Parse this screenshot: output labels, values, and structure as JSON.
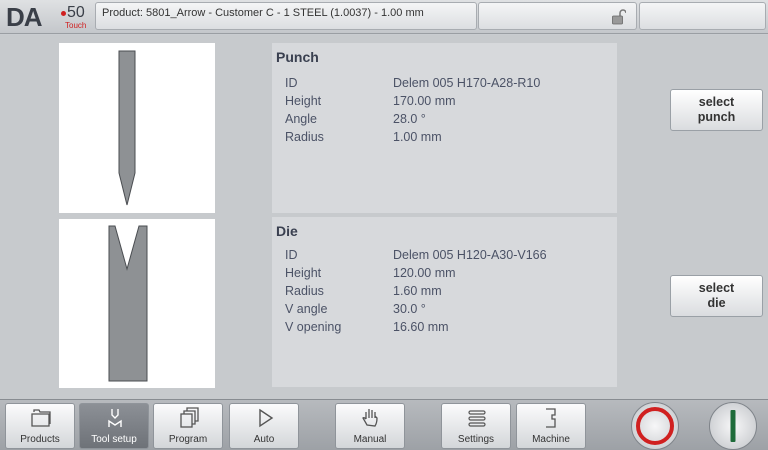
{
  "header": {
    "logo_text": "DA",
    "logo_model": "50",
    "logo_sub": "Touch",
    "product_title": "Product: 5801_Arrow - Customer C - 1 STEEL (1.0037) - 1.00 mm",
    "lock_icon": "unlocked-padlock-icon"
  },
  "punch": {
    "title": "Punch",
    "rows": [
      {
        "key": "ID",
        "value": "Delem 005 H170-A28-R10"
      },
      {
        "key": "Height",
        "value": "170.00 mm"
      },
      {
        "key": "Angle",
        "value": "28.0 °"
      },
      {
        "key": "Radius",
        "value": "1.00 mm"
      }
    ],
    "select_label_1": "select",
    "select_label_2": "punch"
  },
  "die": {
    "title": "Die",
    "rows": [
      {
        "key": "ID",
        "value": "Delem 005 H120-A30-V166"
      },
      {
        "key": "Height",
        "value": "120.00 mm"
      },
      {
        "key": "Radius",
        "value": "1.60 mm"
      },
      {
        "key": "V angle",
        "value": "30.0 °"
      },
      {
        "key": "V opening",
        "value": "16.60 mm"
      }
    ],
    "select_label_1": "select",
    "select_label_2": "die"
  },
  "footer": {
    "tabs": [
      {
        "label": "Products",
        "icon": "folder-icon"
      },
      {
        "label": "Tool setup",
        "icon": "tool-setup-icon",
        "active": true
      },
      {
        "label": "Program",
        "icon": "pages-icon"
      },
      {
        "label": "Auto",
        "icon": "play-icon"
      },
      {
        "label": "Manual",
        "icon": "hand-icon"
      },
      {
        "label": "Settings",
        "icon": "settings-list-icon"
      },
      {
        "label": "Machine",
        "icon": "machine-icon"
      }
    ],
    "stop_icon": "stop-icon",
    "start_icon": "start-icon"
  },
  "colors": {
    "accent_red": "#d02020",
    "start_green": "#1e6b3a",
    "panel_bg": "#d7d9dc",
    "text": "#4b5266"
  }
}
